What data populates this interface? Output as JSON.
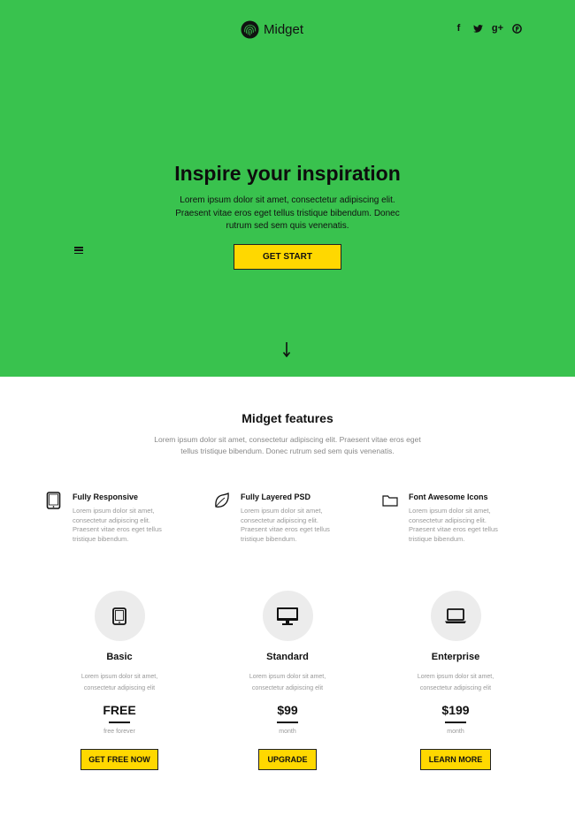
{
  "header": {
    "brand_name": "Midget",
    "logo_icon": "fingerprint-icon",
    "social": [
      {
        "name": "facebook-icon",
        "glyph": "f"
      },
      {
        "name": "twitter-icon",
        "glyph": "t"
      },
      {
        "name": "google-plus-icon",
        "glyph": "g+"
      },
      {
        "name": "pinterest-icon",
        "glyph": "p"
      }
    ]
  },
  "hero": {
    "title": "Inspire your inspiration",
    "lead": "Lorem ipsum dolor sit amet, consectetur adipiscing elit. Praesent vitae eros eget tellus tristique bibendum. Donec rutrum sed sem quis venenatis.",
    "cta_label": "GET START",
    "menu_icon": "hamburger-menu-icon",
    "scroll_icon": "arrow-down-icon",
    "background_color": "#39c24e"
  },
  "features": {
    "title": "Midget features",
    "subtitle": "Lorem ipsum dolor sit amet, consectetur adipiscing elit. Praesent vitae eros eget tellus tristique bibendum. Donec rutrum sed sem quis venenatis.",
    "items": [
      {
        "icon": "tablet-icon",
        "title": "Fully Responsive",
        "desc": "Lorem ipsum dolor sit amet, consectetur adipiscing elit. Praesent vitae eros eget tellus tristique bibendum."
      },
      {
        "icon": "leaf-icon",
        "title": "Fully Layered PSD",
        "desc": "Lorem ipsum dolor sit amet, consectetur adipiscing elit. Praesent vitae eros eget tellus tristique bibendum."
      },
      {
        "icon": "folder-icon",
        "title": "Font Awesome Icons",
        "desc": "Lorem ipsum dolor sit amet, consectetur adipiscing elit. Praesent vitae eros eget tellus tristique bibendum."
      }
    ]
  },
  "pricing": {
    "plans": [
      {
        "icon": "tablet-icon",
        "name": "Basic",
        "desc": "Lorem ipsum dolor sit amet, consectetur adipiscing elit",
        "price": "FREE",
        "period": "free forever",
        "button": "GET FREE NOW"
      },
      {
        "icon": "desktop-icon",
        "name": "Standard",
        "desc": "Lorem ipsum dolor sit amet, consectetur adipiscing elit",
        "price": "$99",
        "period": "month",
        "button": "UPGRADE"
      },
      {
        "icon": "laptop-icon",
        "name": "Enterprise",
        "desc": "Lorem ipsum dolor sit amet, consectetur adipiscing elit",
        "price": "$199",
        "period": "month",
        "button": "LEARN MORE"
      }
    ]
  },
  "colors": {
    "accent_green": "#39c24e",
    "button_yellow": "#ffd800",
    "text_dark": "#111111",
    "text_muted": "#999999"
  }
}
